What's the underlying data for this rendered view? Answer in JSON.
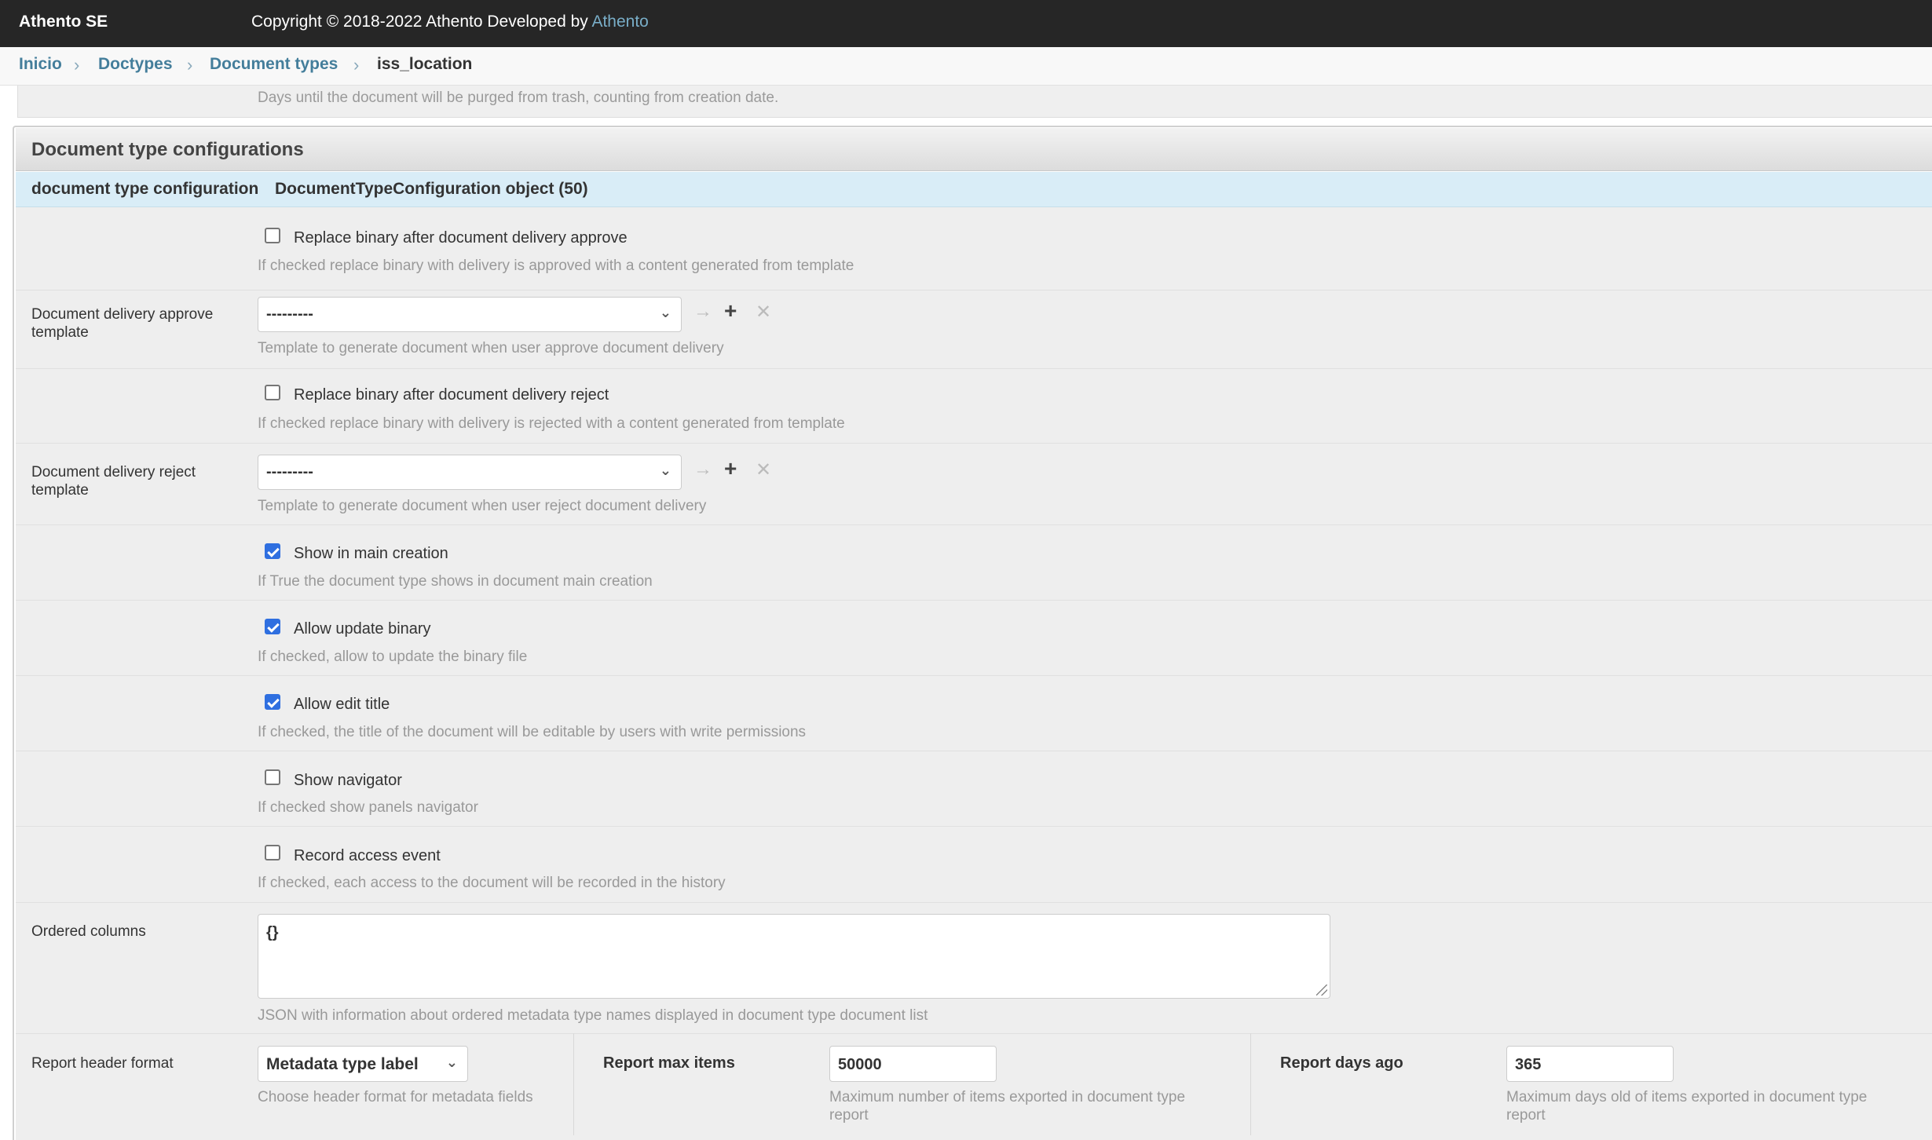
{
  "header": {
    "brand": "Athento SE",
    "copyright_prefix": "Copyright © 2018-2022 Athento Developed by ",
    "copyright_link": "Athento"
  },
  "breadcrumbs": [
    "Inicio",
    "Doctypes",
    "Document types",
    "iss_location"
  ],
  "previous_help": "Days until the document will be purged from trash, counting from creation date.",
  "fieldset": {
    "title": "Document type configurations",
    "inline_label": "document type configuration",
    "inline_object": "DocumentTypeConfiguration object (50)"
  },
  "fields": {
    "replace_approve": {
      "label": "Replace binary after document delivery approve",
      "checked": false,
      "help": "If checked replace binary with delivery is approved with a content generated from template"
    },
    "approve_template": {
      "label": "Document delivery approve template",
      "value": "---------",
      "help": "Template to generate document when user approve document delivery"
    },
    "replace_reject": {
      "label": "Replace binary after document delivery reject",
      "checked": false,
      "help": "If checked replace binary with delivery is rejected with a content generated from template"
    },
    "reject_template": {
      "label": "Document delivery reject template",
      "value": "---------",
      "help": "Template to generate document when user reject document delivery"
    },
    "show_main_creation": {
      "label": "Show in main creation",
      "checked": true,
      "help": "If True the document type shows in document main creation"
    },
    "allow_update_binary": {
      "label": "Allow update binary",
      "checked": true,
      "help": "If checked, allow to update the binary file"
    },
    "allow_edit_title": {
      "label": "Allow edit title",
      "checked": true,
      "help": "If checked, the title of the document will be editable by users with write permissions"
    },
    "show_navigator": {
      "label": "Show navigator",
      "checked": false,
      "help": "If checked show panels navigator"
    },
    "record_access": {
      "label": "Record access event",
      "checked": false,
      "help": "If checked, each access to the document will be recorded in the history"
    },
    "ordered_columns": {
      "label": "Ordered columns",
      "value": "{}",
      "help": "JSON with information about ordered metadata type names displayed in document type document list"
    },
    "report_header_format": {
      "label": "Report header format",
      "value": "Metadata type label",
      "help": "Choose header format for metadata fields"
    },
    "report_max_items": {
      "label": "Report max items",
      "value": "50000",
      "help_line1": "Maximum number of items exported in document type",
      "help_line2": "report"
    },
    "report_days_ago": {
      "label": "Report days ago",
      "value": "365",
      "help_line1": "Maximum days old of items exported in document type",
      "help_line2": "report"
    }
  },
  "icons": {
    "select_chevron": "chevron-down-icon",
    "change": "arrow-right-icon",
    "add": "plus-icon",
    "delete": "close-icon"
  }
}
